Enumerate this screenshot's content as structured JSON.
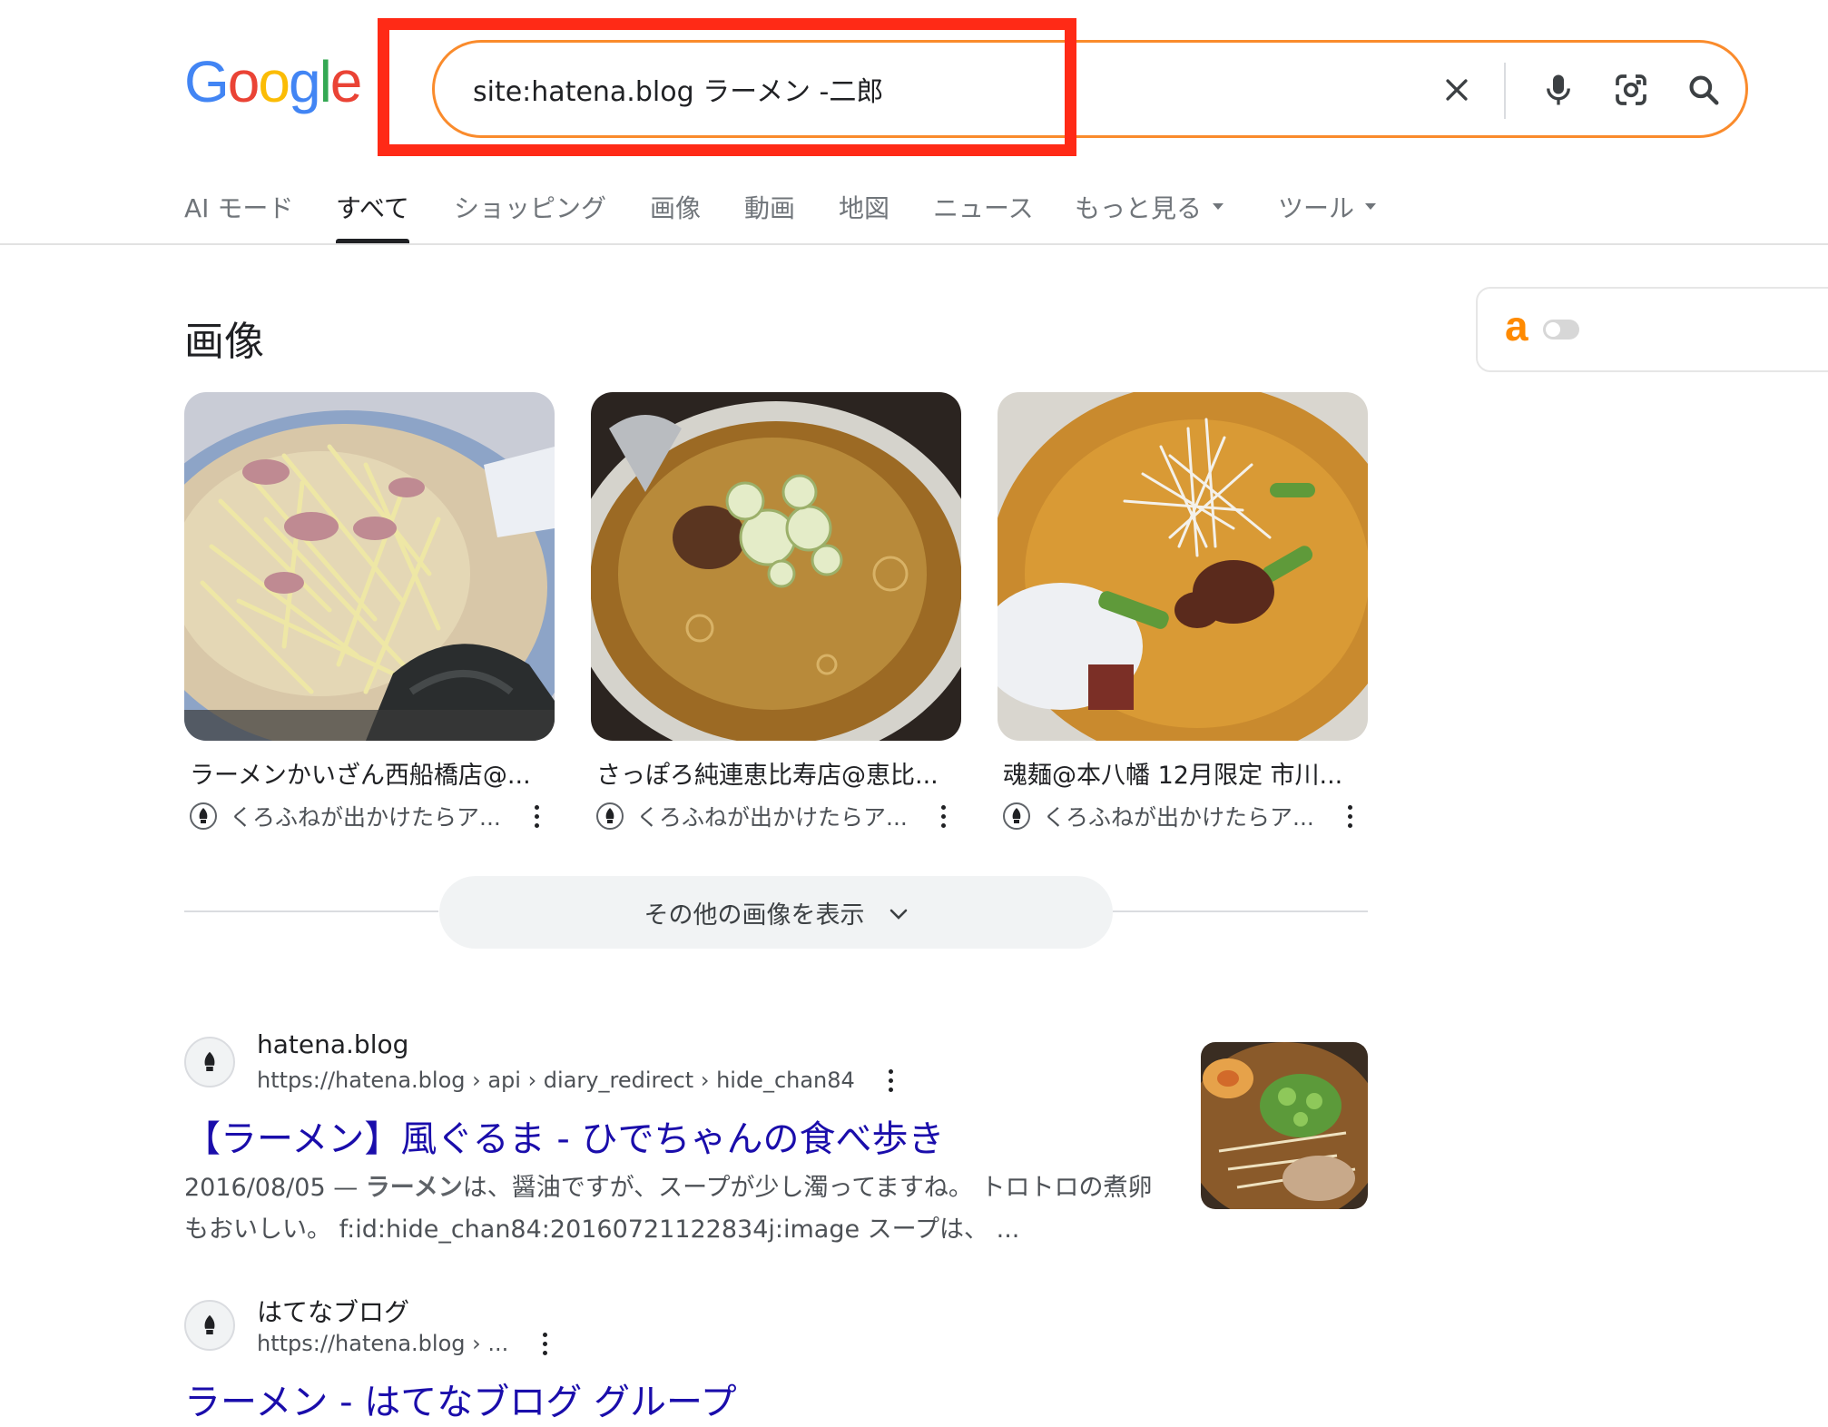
{
  "search": {
    "query": "site:hatena.blog ラーメン -二郎"
  },
  "logo": {
    "letters": [
      "G",
      "o",
      "o",
      "g",
      "l",
      "e"
    ],
    "colors": [
      "#4285f4",
      "#ea4335",
      "#fbbc05",
      "#4285f4",
      "#34a853",
      "#ea4335"
    ]
  },
  "tabs": [
    {
      "label": "AI モード"
    },
    {
      "label": "すべて"
    },
    {
      "label": "ショッピング"
    },
    {
      "label": "画像"
    },
    {
      "label": "動画"
    },
    {
      "label": "地図"
    },
    {
      "label": "ニュース"
    },
    {
      "label": "もっと見る"
    },
    {
      "label": "ツール"
    }
  ],
  "side_widget": {
    "mark": "a"
  },
  "images_section": {
    "title": "画像",
    "cards": [
      {
        "title": "ラーメンかいざん西船橋店@...",
        "source": "くろふねが出かけたらア..."
      },
      {
        "title": "さっぽろ純連恵比寿店@恵比...",
        "source": "くろふねが出かけたらア..."
      },
      {
        "title": "魂麺@本八幡 12月限定 市川...",
        "source": "くろふねが出かけたらア..."
      }
    ],
    "more_label": "その他の画像を表示"
  },
  "results": [
    {
      "site_name": "hatena.blog",
      "url": "https://hatena.blog › api › diary_redirect › hide_chan84",
      "title": "【ラーメン】風ぐるま - ひでちゃんの食べ歩き",
      "snippet_date": "2016/08/05 — ",
      "snippet_bold": "ラーメン",
      "snippet_rest": "は、醤油ですが、スープが少し濁ってますね。 トロトロの煮卵もおいしい。 f:id:hide_chan84:20160721122834j:image スープは、 ..."
    },
    {
      "site_name": "はてなブログ",
      "url": "https://hatena.blog › ...",
      "title": "ラーメン - はてなブログ グループ"
    }
  ],
  "colors": {
    "search_border": "#fa8b2c",
    "highlight": "#ff2a16",
    "link": "#1a0dab",
    "side_mark": "#ff8a00"
  },
  "icons": [
    "clear-icon",
    "mic-icon",
    "lens-icon",
    "search-icon",
    "hatena-favicon",
    "more-vert-icon",
    "chevron-down-icon"
  ]
}
